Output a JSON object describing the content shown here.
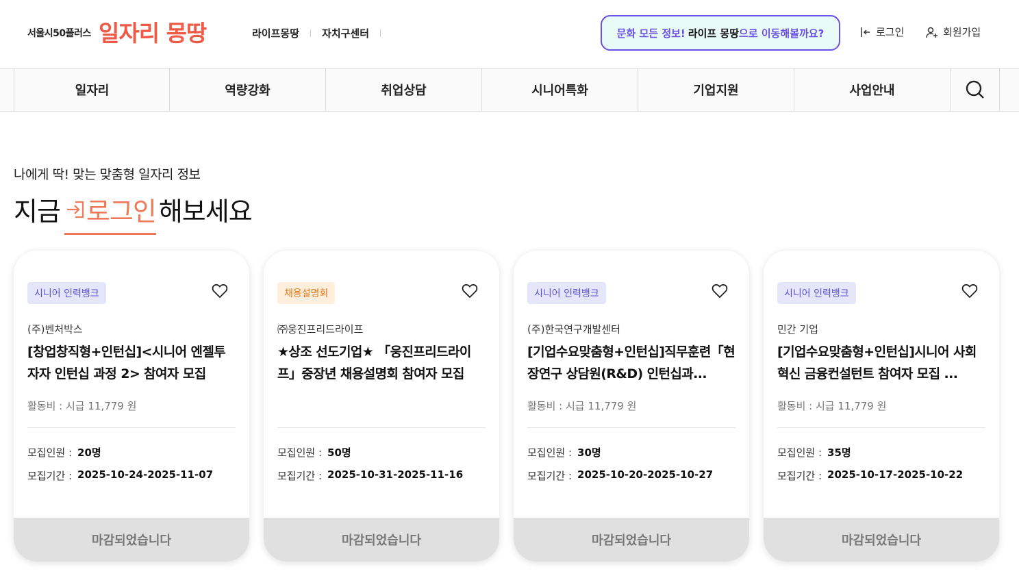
{
  "header": {
    "logo_small": "서울시50플러스",
    "logo_big": "일자리 몽땅",
    "nav": [
      "라이프몽땅",
      "자치구센터"
    ],
    "promo": {
      "part1": "문화 모든 정보!",
      "part2": "라이프 몽땅",
      "part3": "으로 이동해볼까요?"
    },
    "login": "로그인",
    "join": "회원가입"
  },
  "category_nav": [
    "일자리",
    "역량강화",
    "취업상담",
    "시니어특화",
    "기업지원",
    "사업안내"
  ],
  "hero": {
    "subtitle": "나에게 딱! 맞는 맞춤형 일자리 정보",
    "title_prefix": "지금",
    "title_login": "로그인",
    "title_suffix": "해보세요"
  },
  "cards": [
    {
      "badge": "시니어 인력뱅크",
      "company": "(주)벤처박스",
      "title": "[창업창직형+인턴십]<시니어 엔젤투자자 인턴십 과정 2> 참여자 모집",
      "pay": "활동비 : 시급 11,779 원",
      "recruit_label": "모집인원 :",
      "recruit_value": "20명",
      "period_label": "모집기간 :",
      "period_value": "2025-10-24-2025-11-07",
      "status": "마감되었습니다"
    },
    {
      "badge": "채용설명회",
      "company": "㈜웅진프리드라이프",
      "title": "★상조 선도기업★ 「웅진프리드라이프」중장년 채용설명회 참여자 모집",
      "pay": "",
      "recruit_label": "모집인원 :",
      "recruit_value": "50명",
      "period_label": "모집기간 :",
      "period_value": "2025-10-31-2025-11-16",
      "status": "마감되었습니다"
    },
    {
      "badge": "시니어 인력뱅크",
      "company": "(주)한국연구개발센터",
      "title": "[기업수요맞춤형+인턴십]직무훈련「현장연구 상담원(R&D) 인턴십과...",
      "pay": "활동비 : 시급 11,779 원",
      "recruit_label": "모집인원 :",
      "recruit_value": "30명",
      "period_label": "모집기간 :",
      "period_value": "2025-10-20-2025-10-27",
      "status": "마감되었습니다"
    },
    {
      "badge": "시니어 인력뱅크",
      "company": "민간 기업",
      "title": "[기업수요맞춤형+인턴십]시니어 사회혁신 금융컨설턴트 참여자 모집 ...",
      "pay": "활동비 : 시급 11,779 원",
      "recruit_label": "모집인원 :",
      "recruit_value": "35명",
      "period_label": "모집기간 :",
      "period_value": "2025-10-17-2025-10-22",
      "status": "마감되었습니다"
    }
  ],
  "colors": {
    "brand": "#ef5a47",
    "accent": "#6b50e6",
    "badge_purple": "#5a4fd6",
    "badge_orange": "#e3781b"
  },
  "icons": {
    "login": "login-icon",
    "join": "user-plus-icon",
    "search": "search-icon",
    "favorite": "heart-icon"
  }
}
